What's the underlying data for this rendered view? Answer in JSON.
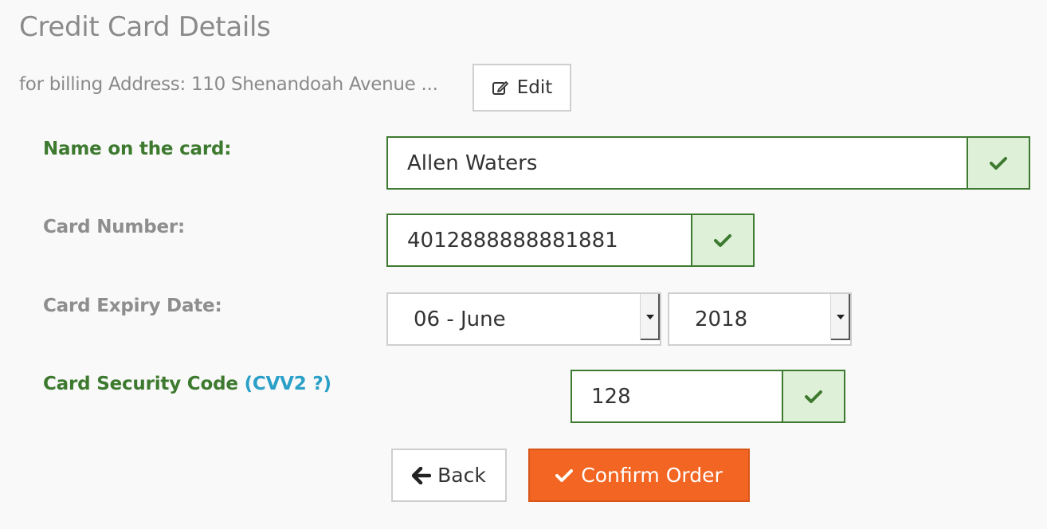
{
  "page": {
    "title": "Credit Card Details",
    "billing_text": "for billing Address: 110 Shenandoah Avenue ...",
    "edit_label": "Edit"
  },
  "form": {
    "name": {
      "label": "Name on the card:",
      "value": "Allen Waters",
      "valid": true
    },
    "card_number": {
      "label": "Card Number:",
      "value": "4012888888881881",
      "valid": true
    },
    "expiry": {
      "label": "Card Expiry Date:",
      "month": "06 - June",
      "year": "2018"
    },
    "cvv": {
      "label": "Card Security Code",
      "link": "(CVV2 ?)",
      "value": "128",
      "valid": true
    }
  },
  "actions": {
    "back_label": "Back",
    "confirm_label": "Confirm Order"
  },
  "colors": {
    "valid_green": "#3d7a2f",
    "valid_bg": "#dff0d8",
    "confirm_orange": "#f26522",
    "link_blue": "#2aa0c8"
  },
  "icons": {
    "edit": "edit-icon",
    "check": "check-icon",
    "back": "arrow-left-icon",
    "dropdown": "caret-down-icon"
  }
}
